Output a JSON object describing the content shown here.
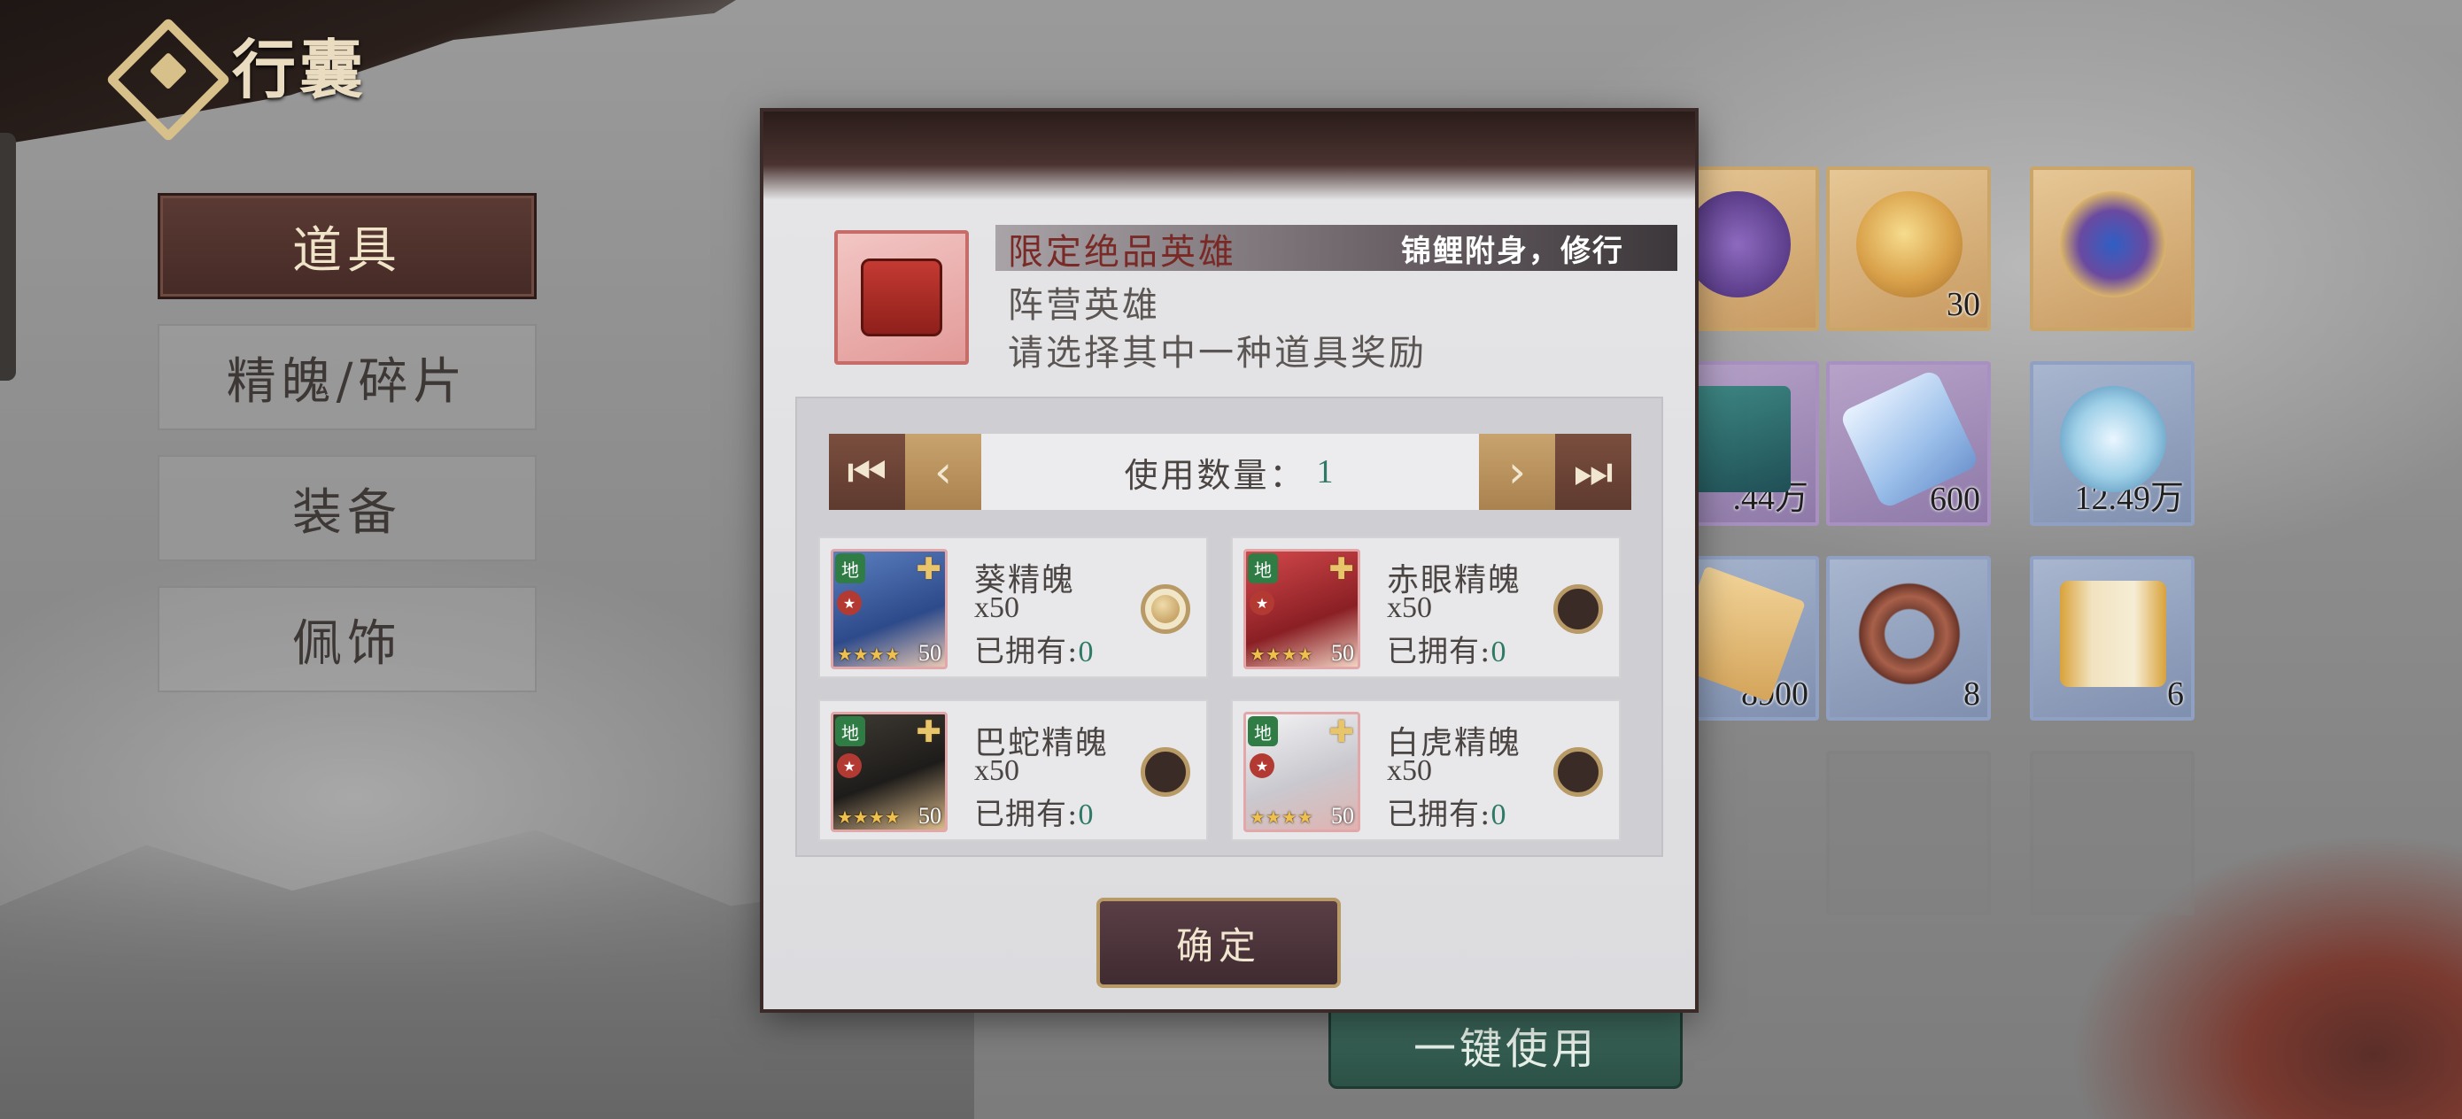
{
  "header": {
    "title": "行囊"
  },
  "sidebar": {
    "items": [
      {
        "label": "道具",
        "active": true
      },
      {
        "label": "精魄/碎片",
        "active": false
      },
      {
        "label": "装备",
        "active": false
      },
      {
        "label": "佩饰",
        "active": false
      }
    ]
  },
  "inventory": {
    "cells": [
      {
        "count": "",
        "rarity": "gold",
        "icon": "purple-banner-icon"
      },
      {
        "count": "30",
        "rarity": "gold",
        "icon": "golden-orb-icon"
      },
      {
        "count": "",
        "rarity": "gold",
        "icon": "blue-gem-amulet-icon"
      },
      {
        "count": ".44万",
        "rarity": "purple",
        "icon": "green-book-icon"
      },
      {
        "count": "600",
        "rarity": "purple",
        "icon": "crystal-shard-icon"
      },
      {
        "count": "12.49万",
        "rarity": "blue",
        "icon": "lotus-flower-icon"
      },
      {
        "count": "8900",
        "rarity": "blue",
        "icon": "paper-ticket-icon"
      },
      {
        "count": "8",
        "rarity": "blue",
        "icon": "prayer-beads-icon"
      },
      {
        "count": "6",
        "rarity": "blue",
        "icon": "scroll-icon"
      }
    ],
    "use_all_label": "一键使用"
  },
  "modal": {
    "reward_name": "限定绝品英雄",
    "scroll_text": "锦鲤附身，修行",
    "subtitle1": "阵营英雄",
    "subtitle2": "请选择其中一种道具奖励",
    "quantity_label": "使用数量：",
    "quantity_value": "1",
    "choices": [
      {
        "name": "葵精魄",
        "qty": "x50",
        "owned_label": "已拥有:",
        "owned": "0",
        "level": "50",
        "selected": true,
        "color": "#5b7fc0",
        "icon": "blue-hair-hero-portrait"
      },
      {
        "name": "赤眼精魄",
        "qty": "x50",
        "owned_label": "已拥有:",
        "owned": "0",
        "level": "50",
        "selected": false,
        "color": "#c0444a",
        "icon": "red-hair-hero-portrait"
      },
      {
        "name": "巴蛇精魄",
        "qty": "x50",
        "owned_label": "已拥有:",
        "owned": "0",
        "level": "50",
        "selected": false,
        "color": "#3e3a33",
        "icon": "dark-hair-hero-portrait"
      },
      {
        "name": "白虎精魄",
        "qty": "x50",
        "owned_label": "已拥有:",
        "owned": "0",
        "level": "50",
        "selected": false,
        "color": "#d8d8dc",
        "icon": "white-hair-hero-portrait"
      }
    ],
    "confirm_label": "确定"
  },
  "colors": {
    "accent_green": "#2e7a66",
    "gold_border": "#b89a66",
    "active_tab": "#4f322d"
  }
}
